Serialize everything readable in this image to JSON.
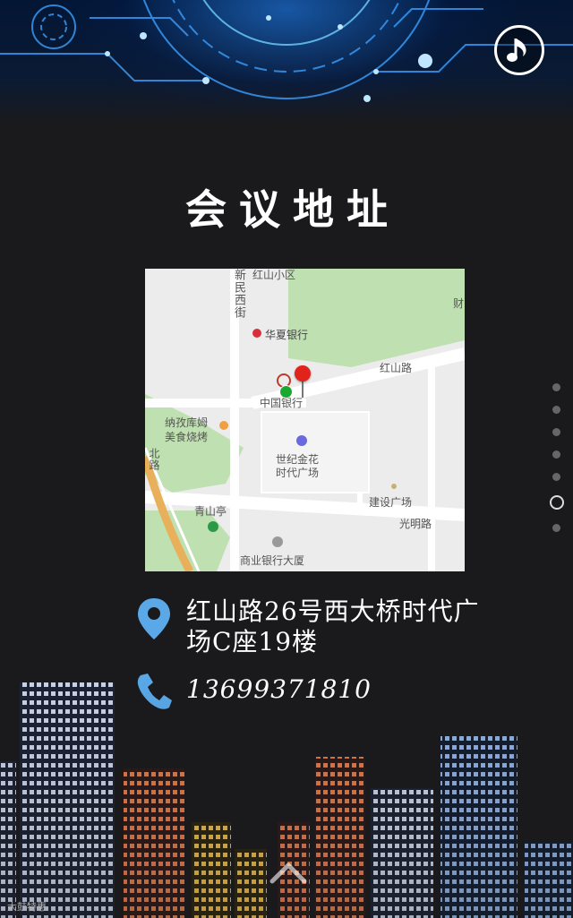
{
  "page": {
    "title": "会议地址",
    "music_icon": "music-note-icon"
  },
  "map": {
    "labels": {
      "hongshan_xiaoqu": "红山小区",
      "xinmin_xijie": "新民西街",
      "huaxia_bank": "华夏银行",
      "hongshan_road": "红山路",
      "bank_of_china": "中国银行",
      "restaurant": "纳孜库姆",
      "restaurant2": "美食烧烤",
      "century_plaza": "世纪金花",
      "century_plaza2": "时代广场",
      "jianshe_square": "建设广场",
      "guangming_road": "光明路",
      "qingshan_pavilion": "青山亭",
      "commercial_bank": "商业银行大厦",
      "bei_road": "北路",
      "cai": "财"
    }
  },
  "contact": {
    "address": "红山路26号西大桥时代广场C座19楼",
    "phone": "13699371810"
  },
  "pager": {
    "count": 7,
    "active_index": 5
  },
  "footer": {
    "watermark": "大鼓特惠"
  },
  "colors": {
    "background": "#1a1a1c",
    "icon_blue": "#5aa8e8",
    "pin_red": "#e0241b",
    "pin_green": "#1aa830"
  }
}
